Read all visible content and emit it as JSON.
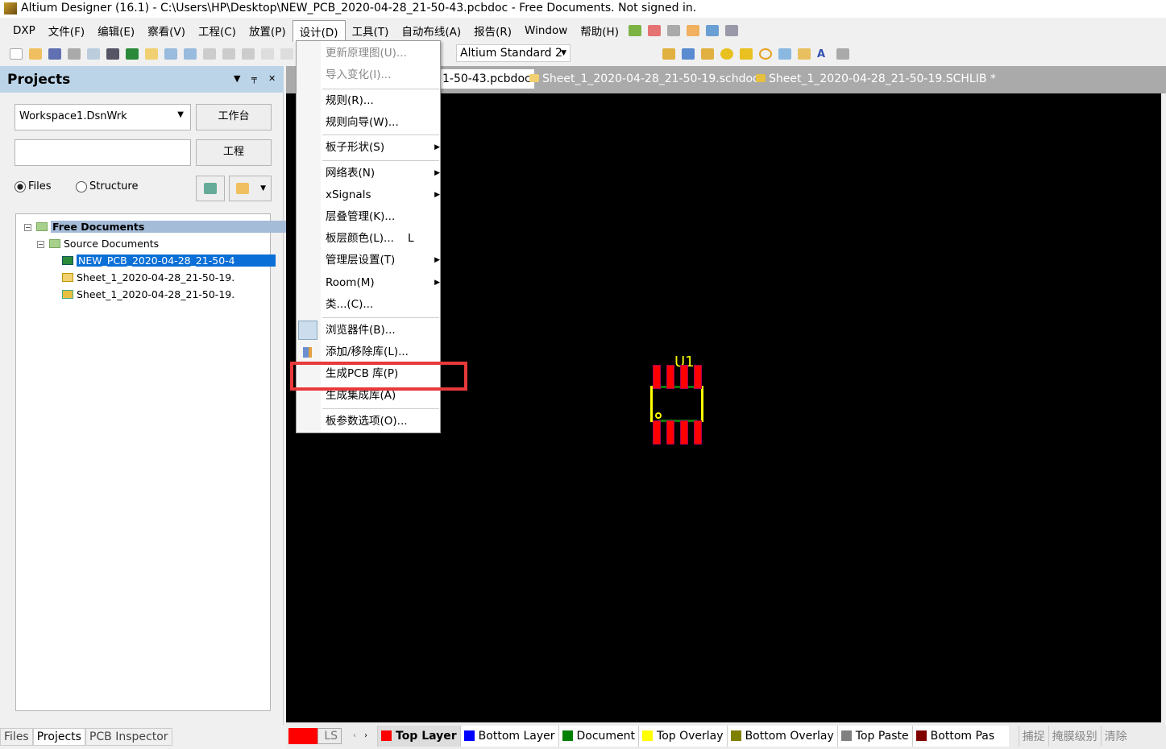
{
  "title": "Altium Designer (16.1) - C:\\Users\\HP\\Desktop\\NEW_PCB_2020-04-28_21-50-43.pcbdoc - Free Documents. Not signed in.",
  "menu": [
    "DXP",
    "文件(F)",
    "编辑(E)",
    "察看(V)",
    "工程(C)",
    "放置(P)",
    "设计(D)",
    "工具(T)",
    "自动布线(A)",
    "报告(R)",
    "Window",
    "帮助(H)"
  ],
  "toolbar": {
    "standard": "Altium Standard 2"
  },
  "panel": {
    "title": "Projects",
    "workspace": "Workspace1.DsnWrk",
    "workbench_btn": "工作台",
    "project_btn": "工程",
    "project_input": "",
    "radio_files": "Files",
    "radio_structure": "Structure",
    "tree": {
      "root": "Free Documents",
      "group": "Source Documents",
      "items": [
        "NEW_PCB_2020-04-28_21-50-4",
        "Sheet_1_2020-04-28_21-50-19.",
        "Sheet_1_2020-04-28_21-50-19."
      ]
    },
    "bottom_tabs": [
      "Files",
      "Projects",
      "PCB Inspector"
    ]
  },
  "doc_tabs": [
    "1-50-43.pcbdoc",
    "Sheet_1_2020-04-28_21-50-19.schdoc",
    "Sheet_1_2020-04-28_21-50-19.SCHLIB *"
  ],
  "design_menu": [
    {
      "label": "更新原理图(U)...",
      "disabled": true
    },
    {
      "label": "导入变化(I)...",
      "disabled": true
    },
    {
      "label": "规则(R)..."
    },
    {
      "label": "规则向导(W)..."
    },
    {
      "label": "板子形状(S)",
      "submenu": true
    },
    {
      "label": "网络表(N)",
      "submenu": true
    },
    {
      "label": "xSignals",
      "submenu": true
    },
    {
      "label": "层叠管理(K)..."
    },
    {
      "label": "板层颜色(L)...",
      "shortcut": "L"
    },
    {
      "label": "管理层设置(T)",
      "submenu": true
    },
    {
      "label": "Room(M)",
      "submenu": true
    },
    {
      "label": "类...(C)..."
    },
    {
      "label": "浏览器件(B)..."
    },
    {
      "label": "添加/移除库(L)..."
    },
    {
      "label": "生成PCB 库(P)",
      "highlighted": true
    },
    {
      "label": "生成集成库(A)"
    },
    {
      "label": "板参数选项(O)..."
    }
  ],
  "component": {
    "designator": "U1"
  },
  "status": {
    "ls": "LS",
    "layers": [
      {
        "name": "Top Layer",
        "color": "#ff0000",
        "active": true
      },
      {
        "name": "Bottom Layer",
        "color": "#0000ff"
      },
      {
        "name": "Document",
        "color": "#008000"
      },
      {
        "name": "Top Overlay",
        "color": "#ffff00"
      },
      {
        "name": "Bottom Overlay",
        "color": "#808000"
      },
      {
        "name": "Top Paste",
        "color": "#808080"
      },
      {
        "name": "Bottom Pas",
        "color": "#800000"
      }
    ],
    "buttons": [
      "捕捉",
      "掩膜级别",
      "清除"
    ]
  }
}
